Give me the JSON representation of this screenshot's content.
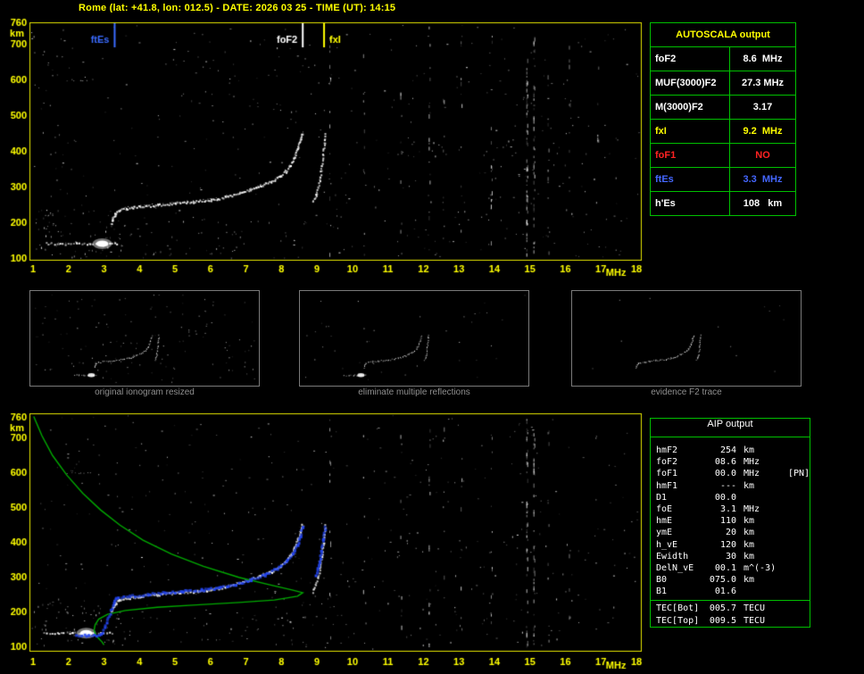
{
  "title": "Rome (lat: +41.8, lon: 012.5) - DATE: 2026 03 25 - TIME (UT): 14:15",
  "autoscala": {
    "header": "AUTOSCALA output",
    "rows": [
      {
        "label": "foF2",
        "value": "8.6  MHz",
        "color": "#ffffff"
      },
      {
        "label": "MUF(3000)F2",
        "value": "27.3 MHz",
        "color": "#ffffff"
      },
      {
        "label": "M(3000)F2",
        "value": "3.17",
        "color": "#ffffff"
      },
      {
        "label": "fxI",
        "value": "9.2  MHz",
        "color": "#ffff00"
      },
      {
        "label": "foF1",
        "value": "NO",
        "color": "#ff2222"
      },
      {
        "label": "ftEs",
        "value": "3.3  MHz",
        "color": "#4466ff"
      },
      {
        "label": "h'Es",
        "value": "108   km",
        "color": "#ffffff"
      }
    ]
  },
  "thumbnails": {
    "captions": [
      "original ionogram resized",
      "eliminate multiple reflections",
      "evidence F2 trace"
    ]
  },
  "aip": {
    "header": "AIP output",
    "rows": [
      {
        "name": "hmF2",
        "value": "254",
        "unit": "km",
        "note": ""
      },
      {
        "name": "foF2",
        "value": "08.6",
        "unit": "MHz",
        "note": ""
      },
      {
        "name": "foF1",
        "value": "00.0",
        "unit": "MHz",
        "note": "[PN]"
      },
      {
        "name": "hmF1",
        "value": "---",
        "unit": "km",
        "note": ""
      },
      {
        "name": "D1",
        "value": "00.0",
        "unit": "",
        "note": ""
      },
      {
        "name": "foE",
        "value": "3.1",
        "unit": "MHz",
        "note": ""
      },
      {
        "name": "hmE",
        "value": "110",
        "unit": "km",
        "note": ""
      },
      {
        "name": "ymE",
        "value": "20",
        "unit": "km",
        "note": ""
      },
      {
        "name": "h_vE",
        "value": "120",
        "unit": "km",
        "note": ""
      },
      {
        "name": "Ewidth",
        "value": "30",
        "unit": "km",
        "note": ""
      },
      {
        "name": "DelN_vE",
        "value": "00.1",
        "unit": "m^(-3)",
        "note": ""
      },
      {
        "name": "B0",
        "value": "075.0",
        "unit": "km",
        "note": ""
      },
      {
        "name": "B1",
        "value": "01.6",
        "unit": "",
        "note": ""
      }
    ],
    "tec_rows": [
      {
        "name": "TEC[Bot]",
        "value": "005.7",
        "unit": "TECU"
      },
      {
        "name": "TEC[Top]",
        "value": "009.5",
        "unit": "TECU"
      }
    ]
  },
  "chart_data": [
    {
      "id": "top-ionogram",
      "type": "scatter",
      "xlabel": "MHz",
      "ylabel": "km",
      "xlim": [
        1,
        18
      ],
      "ylim": [
        100,
        760
      ],
      "x_ticks": [
        1,
        2,
        3,
        4,
        5,
        6,
        7,
        8,
        9,
        10,
        11,
        12,
        13,
        14,
        15,
        16,
        17,
        18
      ],
      "y_ticks": [
        760,
        700,
        600,
        500,
        400,
        300,
        200,
        100
      ],
      "axis_color": "#ffff00",
      "border_color": "#e6e600",
      "markers": [
        {
          "label": "ftEs",
          "freq_mhz": 3.3,
          "color": "#3a6bff",
          "side": "left"
        },
        {
          "label": "foF2",
          "freq_mhz": 8.6,
          "color": "#ffffff",
          "side": "left"
        },
        {
          "label": "fxI",
          "freq_mhz": 9.2,
          "color": "#ffff00",
          "side": "right"
        }
      ],
      "traces": {
        "es_layer": [
          [
            1.35,
            142
          ],
          [
            1.8,
            141
          ],
          [
            2.2,
            142
          ],
          [
            2.6,
            141
          ],
          [
            2.9,
            140
          ],
          [
            3.15,
            141
          ],
          [
            3.35,
            142
          ]
        ],
        "es_blob": [
          2.95,
          140
        ],
        "f2_ordinary": [
          [
            3.2,
            200
          ],
          [
            3.24,
            212
          ],
          [
            3.3,
            224
          ],
          [
            3.4,
            233
          ],
          [
            3.6,
            240
          ],
          [
            4.0,
            245
          ],
          [
            4.5,
            250
          ],
          [
            5.0,
            255
          ],
          [
            5.5,
            259
          ],
          [
            6.0,
            264
          ],
          [
            6.4,
            272
          ],
          [
            6.8,
            283
          ],
          [
            7.1,
            293
          ],
          [
            7.4,
            304
          ],
          [
            7.7,
            316
          ],
          [
            7.95,
            330
          ],
          [
            8.1,
            344
          ],
          [
            8.25,
            363
          ],
          [
            8.35,
            385
          ],
          [
            8.45,
            410
          ],
          [
            8.52,
            432
          ],
          [
            8.57,
            450
          ]
        ],
        "f2_extraordinary": [
          [
            8.85,
            258
          ],
          [
            8.95,
            278
          ],
          [
            9.02,
            300
          ],
          [
            9.08,
            330
          ],
          [
            9.12,
            360
          ],
          [
            9.16,
            395
          ],
          [
            9.19,
            425
          ],
          [
            9.22,
            450
          ]
        ],
        "multiple_echo": [
          [
            1.95,
            598
          ],
          [
            2.3,
            600
          ],
          [
            2.65,
            599
          ]
        ]
      },
      "noise": {
        "seed": 42,
        "dots": 340,
        "streaks": [
          [
            9.35,
            14
          ],
          [
            10.3,
            8
          ],
          [
            11.35,
            10
          ],
          [
            12.15,
            16
          ],
          [
            12.55,
            8
          ],
          [
            13.05,
            10
          ],
          [
            13.9,
            14
          ],
          [
            14.9,
            60
          ],
          [
            15.1,
            48
          ],
          [
            15.5,
            12
          ],
          [
            16.1,
            8
          ],
          [
            16.9,
            6
          ]
        ],
        "clusters": [
          [
            1.0,
            3.6,
            100,
            235,
            70
          ],
          [
            1.0,
            1.9,
            100,
            745,
            30
          ],
          [
            3.6,
            9.0,
            100,
            205,
            45
          ],
          [
            9.0,
            17.7,
            100,
            430,
            70
          ],
          [
            5.0,
            8.6,
            480,
            740,
            25
          ]
        ]
      }
    },
    {
      "id": "bottom-ionogram",
      "type": "scatter",
      "xlabel": "MHz",
      "ylabel": "km",
      "xlim": [
        1,
        18
      ],
      "ylim": [
        100,
        760
      ],
      "x_ticks": [
        1,
        2,
        3,
        4,
        5,
        6,
        7,
        8,
        9,
        10,
        11,
        12,
        13,
        14,
        15,
        16,
        17,
        18
      ],
      "y_ticks": [
        760,
        700,
        600,
        500,
        400,
        300,
        200,
        100
      ],
      "axis_color": "#ffff00",
      "border_color": "#e6e600",
      "traces": {
        "es_layer": [
          [
            1.3,
            140
          ],
          [
            1.7,
            139
          ],
          [
            2.1,
            140
          ],
          [
            2.5,
            138
          ],
          [
            2.9,
            139
          ],
          [
            3.2,
            140
          ]
        ],
        "es_blob": [
          2.5,
          138
        ],
        "f2_ordinary": [
          [
            3.2,
            200
          ],
          [
            3.24,
            212
          ],
          [
            3.3,
            224
          ],
          [
            3.4,
            233
          ],
          [
            3.6,
            240
          ],
          [
            4.0,
            245
          ],
          [
            4.5,
            250
          ],
          [
            5.0,
            255
          ],
          [
            5.5,
            259
          ],
          [
            6.0,
            264
          ],
          [
            6.4,
            272
          ],
          [
            6.8,
            283
          ],
          [
            7.1,
            293
          ],
          [
            7.4,
            304
          ],
          [
            7.7,
            316
          ],
          [
            7.95,
            330
          ],
          [
            8.1,
            344
          ],
          [
            8.25,
            363
          ],
          [
            8.35,
            385
          ],
          [
            8.45,
            410
          ],
          [
            8.52,
            432
          ],
          [
            8.57,
            450
          ]
        ],
        "f2_extraordinary": [
          [
            8.85,
            258
          ],
          [
            8.95,
            278
          ],
          [
            9.02,
            300
          ],
          [
            9.08,
            330
          ],
          [
            9.12,
            360
          ],
          [
            9.16,
            395
          ],
          [
            9.19,
            425
          ],
          [
            9.22,
            450
          ]
        ],
        "multiple_echo": [
          [
            1.95,
            598
          ],
          [
            2.3,
            600
          ],
          [
            2.65,
            599
          ]
        ]
      },
      "restored_trace": {
        "color": "#2244ee",
        "ordinary": [
          [
            2.2,
            134
          ],
          [
            2.55,
            134
          ],
          [
            2.9,
            136
          ],
          [
            3.3,
            240
          ],
          [
            3.7,
            247
          ],
          [
            4.2,
            252
          ],
          [
            4.7,
            257
          ],
          [
            5.2,
            261
          ],
          [
            5.7,
            265
          ],
          [
            6.2,
            270
          ],
          [
            6.7,
            281
          ],
          [
            7.1,
            294
          ],
          [
            7.5,
            308
          ],
          [
            7.85,
            326
          ],
          [
            8.1,
            346
          ],
          [
            8.3,
            368
          ],
          [
            8.42,
            394
          ],
          [
            8.5,
            420
          ],
          [
            8.57,
            448
          ]
        ],
        "extraordinary": [
          [
            8.95,
            305
          ],
          [
            9.03,
            340
          ],
          [
            9.1,
            378
          ],
          [
            9.15,
            412
          ],
          [
            9.2,
            445
          ]
        ]
      },
      "profile": {
        "color": "#00aa00",
        "points": [
          [
            1.02,
            760
          ],
          [
            1.25,
            705
          ],
          [
            1.55,
            648
          ],
          [
            1.95,
            592
          ],
          [
            2.4,
            540
          ],
          [
            2.9,
            492
          ],
          [
            3.45,
            448
          ],
          [
            4.1,
            405
          ],
          [
            4.9,
            365
          ],
          [
            5.8,
            330
          ],
          [
            6.8,
            298
          ],
          [
            7.7,
            276
          ],
          [
            8.3,
            262
          ],
          [
            8.6,
            254
          ],
          [
            8.45,
            244
          ],
          [
            7.8,
            233
          ],
          [
            6.8,
            226
          ],
          [
            5.6,
            219
          ],
          [
            4.5,
            212
          ],
          [
            3.6,
            203
          ],
          [
            3.1,
            192
          ],
          [
            2.85,
            178
          ],
          [
            2.75,
            162
          ],
          [
            2.72,
            146
          ],
          [
            2.78,
            130
          ],
          [
            2.95,
            112
          ],
          [
            3.0,
            104
          ]
        ]
      },
      "noise": {
        "seed": 1337,
        "dots": 380,
        "streaks": [
          [
            9.35,
            12
          ],
          [
            10.3,
            6
          ],
          [
            11.35,
            8
          ],
          [
            12.15,
            14
          ],
          [
            12.55,
            6
          ],
          [
            13.05,
            8
          ],
          [
            13.9,
            12
          ],
          [
            14.9,
            55
          ],
          [
            15.1,
            45
          ],
          [
            15.5,
            10
          ],
          [
            16.1,
            6
          ]
        ],
        "clusters": [
          [
            1.0,
            3.6,
            100,
            240,
            60
          ],
          [
            9.0,
            17.7,
            100,
            430,
            70
          ],
          [
            3.6,
            9.0,
            100,
            205,
            35
          ]
        ]
      }
    }
  ]
}
